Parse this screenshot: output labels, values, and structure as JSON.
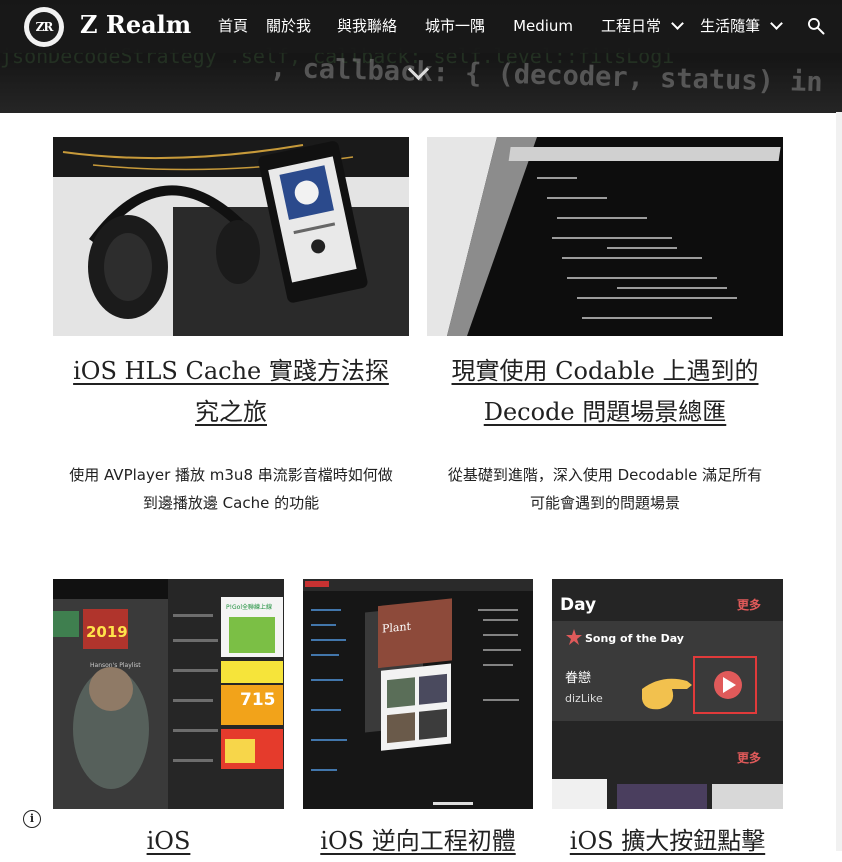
{
  "site": {
    "title": "Z Realm",
    "logo_text": "ZR"
  },
  "nav": {
    "items": [
      {
        "label": "首頁",
        "dropdown": false
      },
      {
        "label": "關於我",
        "dropdown": false
      },
      {
        "label": "與我聯絡",
        "dropdown": false
      },
      {
        "label": "城市一隅",
        "dropdown": false
      },
      {
        "label": "Medium",
        "dropdown": false
      },
      {
        "label": "工程日常",
        "dropdown": true
      },
      {
        "label": "生活隨筆",
        "dropdown": true
      }
    ]
  },
  "hero": {
    "code_text": ", callback: { (decoder, status) in",
    "code_text_top": "jsonDecodeStrategy .self, callback: self.level::filsLogi"
  },
  "posts": [
    {
      "title": "iOS HLS Cache 實踐方法探究之旅",
      "title_line1": "iOS HLS Cache 實踐方法探",
      "title_line2": "究之旅",
      "desc_line1": "使用 AVPlayer 播放 m3u8 串流影音檔時如何做",
      "desc_line2": "到邊播放邊 Cache 的功能",
      "thumb_alt": "headphones-and-phone"
    },
    {
      "title": "現實使用 Codable 上遇到的 Decode 問題場景總匯",
      "title_line1": "現實使用 Codable 上遇到的",
      "title_line2": "Decode 問題場景總匯",
      "desc_line1": "從基礎到進階，深入使用 Decodable 滿足所有",
      "desc_line2": "可能會遇到的問題場景",
      "thumb_alt": "code-on-screen"
    }
  ],
  "posts_row2": [
    {
      "title": "iOS",
      "thumb": {
        "tag": "2019",
        "promo_price": "715",
        "promo_label": "P!Gol全聯練上線",
        "caption": "Hanson's Playlist"
      }
    },
    {
      "title": "iOS 逆向工程初體",
      "thumb": {
        "app_label": "Plant"
      }
    },
    {
      "title": "iOS 擴大按鈕點擊",
      "thumb": {
        "header": "Day",
        "more": "更多",
        "section": "Song of the Day",
        "song": "眷戀",
        "artist": "dizLike",
        "more2": "更多"
      }
    }
  ],
  "colors": {
    "header_bg": "#1a1a1a",
    "text": "#212121",
    "accent": "#e05a5a"
  }
}
